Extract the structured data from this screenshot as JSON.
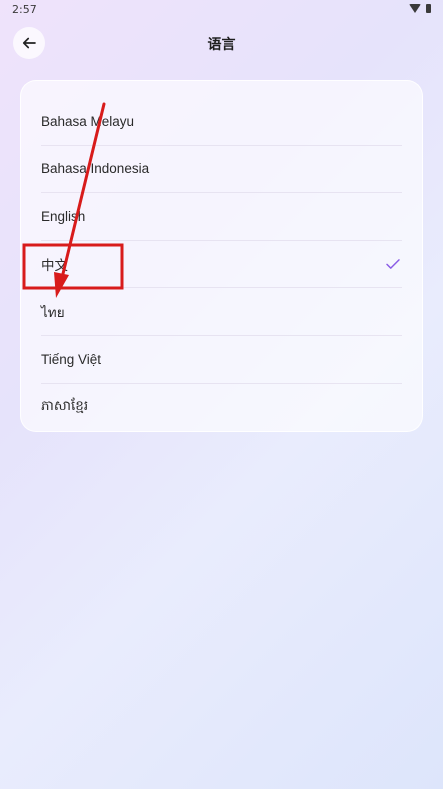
{
  "status_bar": {
    "time": "2:57",
    "wifi_icon": "wifi-icon",
    "battery_icon": "battery-icon"
  },
  "app_bar": {
    "title": "语言",
    "back_icon": "arrow-left-icon"
  },
  "languages": [
    {
      "label": "Bahasa Melayu",
      "selected": false
    },
    {
      "label": "Bahasa Indonesia",
      "selected": false
    },
    {
      "label": "English",
      "selected": false
    },
    {
      "label": "中文",
      "selected": true
    },
    {
      "label": "ไทย",
      "selected": false
    },
    {
      "label": "Tiếng Việt",
      "selected": false
    },
    {
      "label": "ភាសាខ្មែរ",
      "selected": false
    }
  ],
  "colors": {
    "check": "#8a5ce6",
    "annotation": "#d81b1b"
  }
}
